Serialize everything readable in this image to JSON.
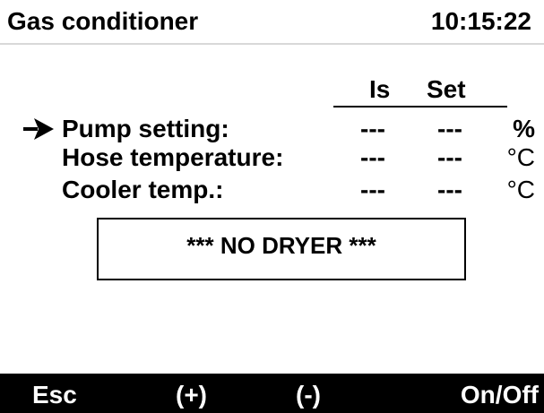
{
  "header": {
    "title": "Gas conditioner",
    "time": "10:15:22"
  },
  "columns": {
    "is_label": "Is",
    "set_label": "Set"
  },
  "rows": [
    {
      "label": "Pump setting:",
      "is_value": "---",
      "set_value": "---",
      "unit": "%",
      "selected": true
    },
    {
      "label": "Hose temperature:",
      "is_value": "---",
      "set_value": "---",
      "unit": "°C",
      "selected": false
    },
    {
      "label": "Cooler temp.:",
      "is_value": "---",
      "set_value": "---",
      "unit": "°C",
      "selected": false
    }
  ],
  "message": "*** NO DRYER ***",
  "softkeys": {
    "key1": "Esc",
    "key2": "(+)",
    "key3": "(-)",
    "key4": "On/Off"
  },
  "icons": {
    "cursor": "arrow-right-icon"
  },
  "colors": {
    "background": "#ffffff",
    "foreground": "#000000",
    "softkey_bar": "#000000",
    "softkey_text": "#ffffff"
  }
}
